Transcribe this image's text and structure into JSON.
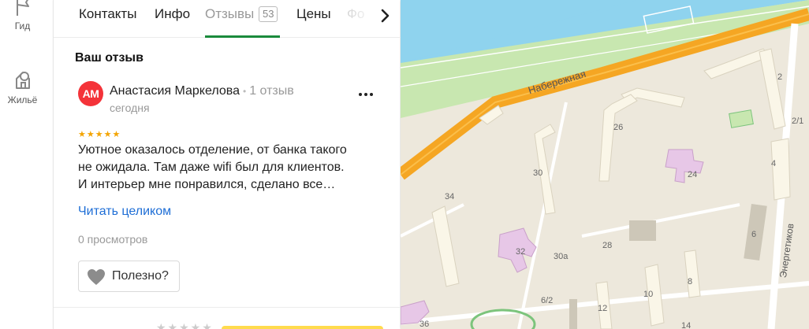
{
  "rail": {
    "items": [
      {
        "label": "Гид",
        "icon": "flag-icon"
      },
      {
        "label": "Жильё",
        "icon": "house-icon"
      }
    ]
  },
  "tabs": [
    {
      "label": "Контакты",
      "active": false
    },
    {
      "label": "Инфо",
      "active": false
    },
    {
      "label": "Отзывы",
      "active": true,
      "count": "53"
    },
    {
      "label": "Цены",
      "active": false
    },
    {
      "label": "Фо",
      "active": false
    }
  ],
  "review_section": {
    "title": "Ваш отзыв",
    "review": {
      "avatar_initials": "АМ",
      "author": "Анастасия Маркелова",
      "separator": "•",
      "author_reviews": "1 отзыв",
      "date": "сегодня",
      "stars": "★★★★★",
      "rating": 5,
      "text_lines": [
        "Уютное оказалось отделение, от банка такого",
        "не ожидала. Там даже wifi был для клиентов.",
        "И интерьер мне понравился, сделано все…"
      ],
      "read_more": "Читать целиком",
      "views": "0 просмотров",
      "helpful_label": "Полезно?"
    },
    "bottom_stars": "★★★★★"
  },
  "map": {
    "street_labels": [
      "Набережная",
      "Энергетиков"
    ],
    "house_numbers": [
      "2",
      "2/1",
      "4",
      "6",
      "8",
      "10",
      "12",
      "14",
      "24",
      "26",
      "28",
      "30",
      "30а",
      "32",
      "34",
      "36",
      "6/2"
    ],
    "colors": {
      "water": "#8fd3ee",
      "park": "#c8e7b0",
      "road": "#f5a623",
      "ground": "#ede8dc",
      "building": "#faf6e8",
      "school": "#e7c7e7"
    }
  }
}
